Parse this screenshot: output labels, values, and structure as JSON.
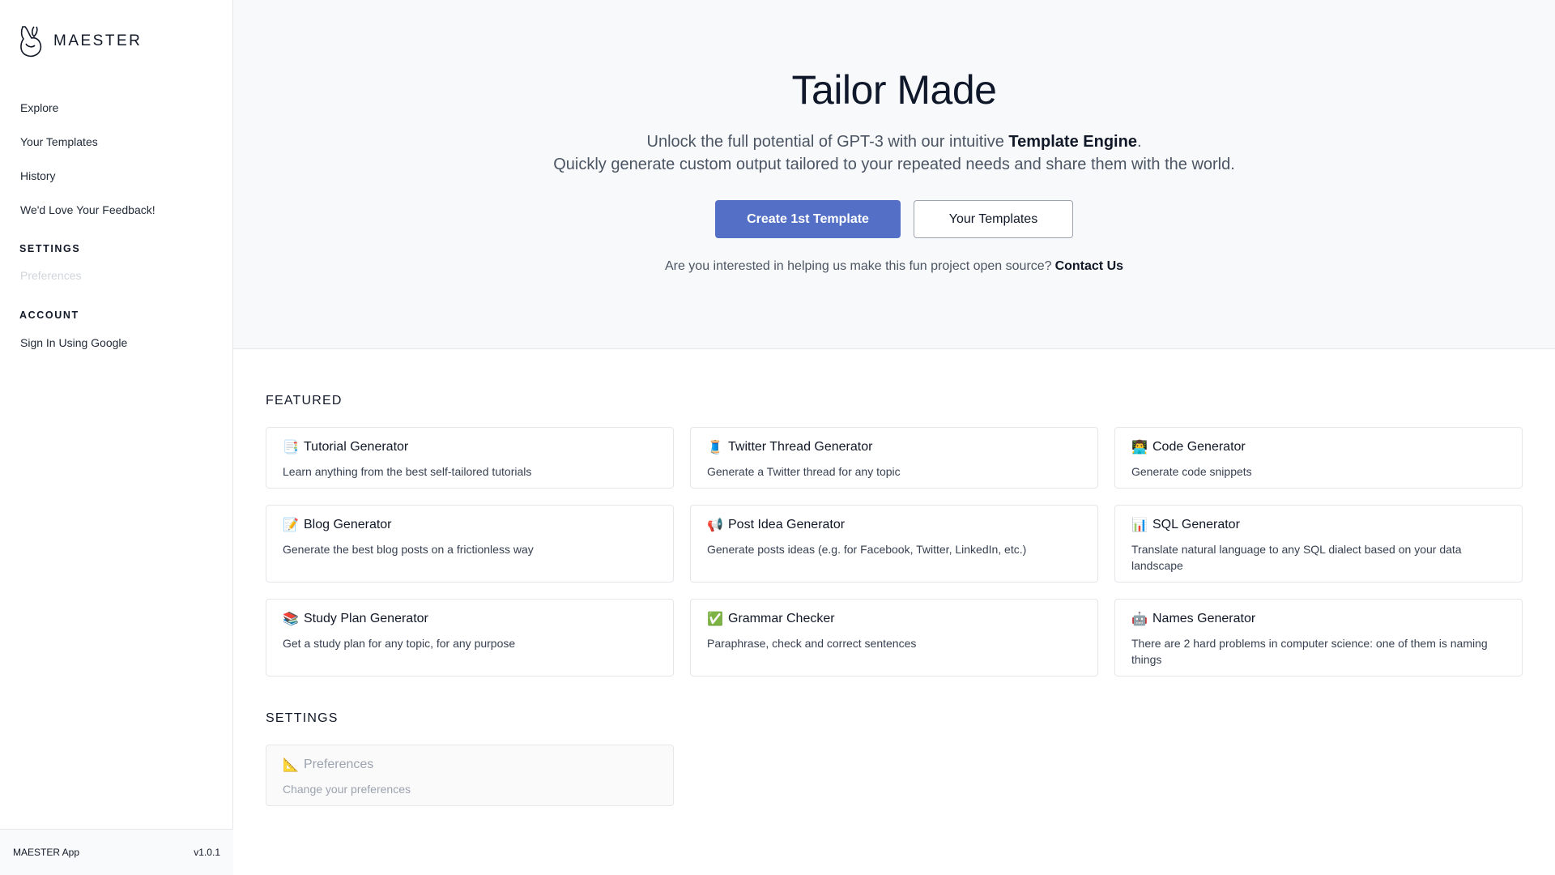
{
  "brand": {
    "name": "MAESTER",
    "logo": "maester-logo-icon"
  },
  "nav": [
    {
      "label": "Explore"
    },
    {
      "label": "Your Templates"
    },
    {
      "label": "History"
    },
    {
      "label": "We'd Love Your Feedback!"
    }
  ],
  "settings_section": {
    "title": "SETTINGS",
    "preferences": "Preferences"
  },
  "account_section": {
    "title": "ACCOUNT",
    "sign_in": "Sign In Using Google"
  },
  "footer": {
    "app": "MAESTER App",
    "version": "v1.0.1"
  },
  "hero": {
    "title": "Tailor Made",
    "sub_before": "Unlock the full potential of GPT-3 with our intuitive ",
    "sub_strong": "Template Engine",
    "sub_after": ".",
    "sub_line2": "Quickly generate custom output tailored to your repeated needs and share them with the world.",
    "primary_button": "Create 1st Template",
    "secondary_button": "Your Templates",
    "contact_text": "Are you interested in helping us make this fun project open source?",
    "contact_link": "Contact Us"
  },
  "featured": {
    "title": "FEATURED",
    "cards": [
      {
        "emoji": "📑",
        "title": "Tutorial Generator",
        "desc": "Learn anything from the best self-tailored tutorials"
      },
      {
        "emoji": "🧵",
        "title": "Twitter Thread Generator",
        "desc": "Generate a Twitter thread for any topic"
      },
      {
        "emoji": "👨‍💻",
        "title": "Code Generator",
        "desc": "Generate code snippets"
      },
      {
        "emoji": "📝",
        "title": "Blog Generator",
        "desc": "Generate the best blog posts on a frictionless way"
      },
      {
        "emoji": "📢",
        "title": "Post Idea Generator",
        "desc": "Generate posts ideas (e.g. for Facebook, Twitter, LinkedIn, etc.)"
      },
      {
        "emoji": "📊",
        "title": "SQL Generator",
        "desc": "Translate natural language to any SQL dialect based on your data landscape"
      },
      {
        "emoji": "📚",
        "title": "Study Plan Generator",
        "desc": "Get a study plan for any topic, for any purpose"
      },
      {
        "emoji": "✅",
        "title": "Grammar Checker",
        "desc": "Paraphrase, check and correct sentences"
      },
      {
        "emoji": "🤖",
        "title": "Names Generator",
        "desc": "There are 2 hard problems in computer science: one of them is naming things"
      }
    ]
  },
  "settings_group": {
    "title": "SETTINGS",
    "cards": [
      {
        "emoji": "📐",
        "title": "Preferences",
        "desc": "Change your preferences"
      }
    ]
  },
  "colors": {
    "accent": "#5470c6",
    "hero_bg": "#f8f9fa",
    "border": "#e5e7eb"
  }
}
